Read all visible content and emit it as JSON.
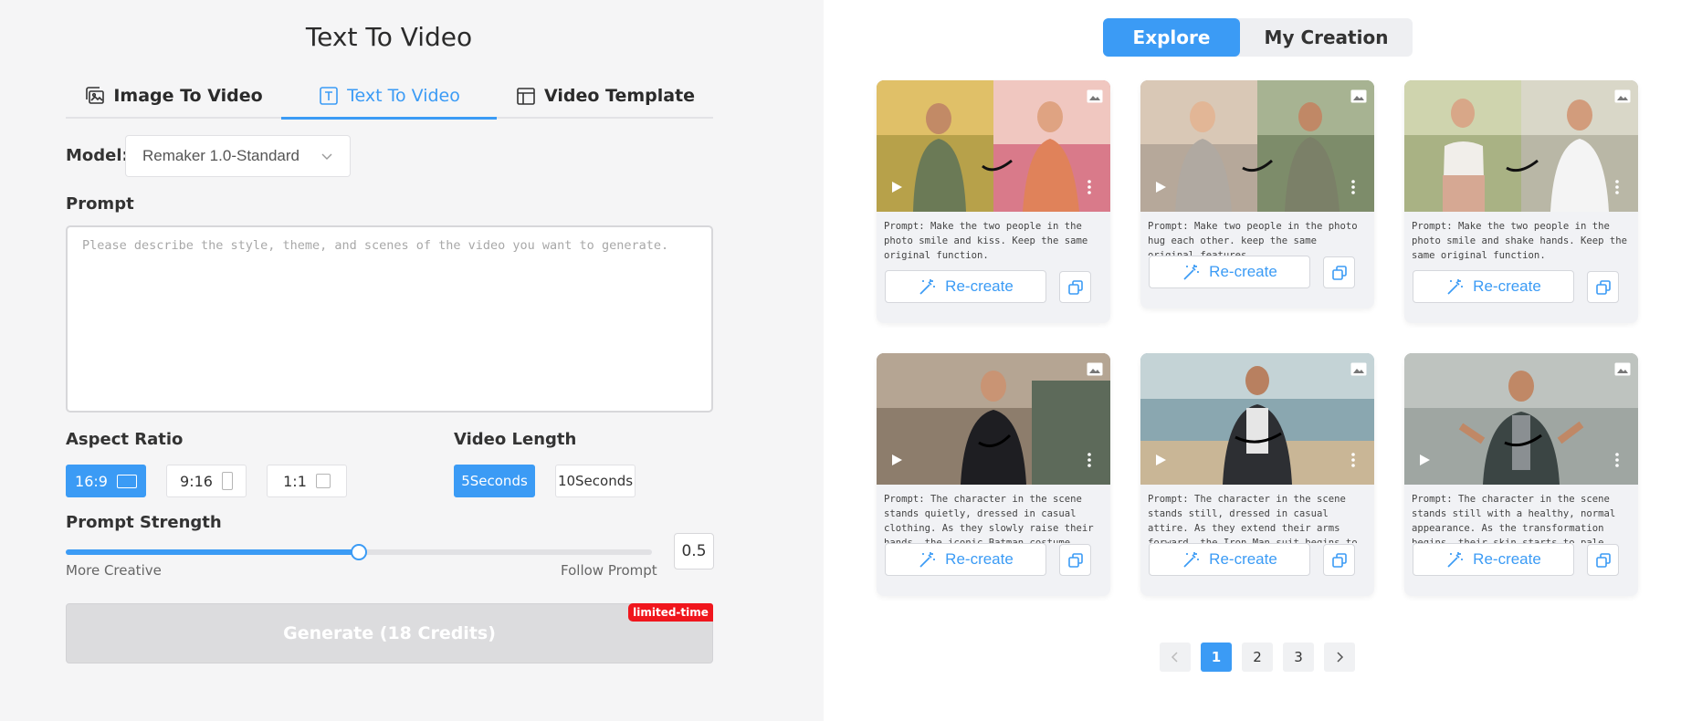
{
  "left_panel": {
    "title": "Text To Video",
    "tabs": [
      {
        "label": "Image To Video",
        "icon": "image-stack-icon",
        "active": false
      },
      {
        "label": "Text To Video",
        "icon": "text-box-icon",
        "active": true
      },
      {
        "label": "Video Template",
        "icon": "template-icon",
        "active": false
      }
    ],
    "model": {
      "label": "Model:",
      "value": "Remaker 1.0-Standard"
    },
    "prompt": {
      "label": "Prompt",
      "placeholder": "Please describe the style, theme, and scenes of the video you want to generate.",
      "value": ""
    },
    "aspect_ratio": {
      "label": "Aspect Ratio",
      "options": [
        "16:9",
        "9:16",
        "1:1"
      ],
      "selected": "16:9"
    },
    "video_length": {
      "label": "Video Length",
      "options": [
        "5Seconds",
        "10Seconds"
      ],
      "selected": "5Seconds"
    },
    "prompt_strength": {
      "label": "Prompt Strength",
      "value": 0.5,
      "value_text": "0.5",
      "left_caption": "More Creative",
      "right_caption": "Follow Prompt"
    },
    "generate": {
      "label": "Generate (18 Credits)",
      "badge": "limited-time"
    }
  },
  "right_panel": {
    "segment": {
      "explore": "Explore",
      "mine": "My Creation",
      "active": "Explore"
    },
    "cards": [
      {
        "prompt": "Prompt: Make the two people in the photo smile and kiss. Keep the same original function.",
        "recreate": "Re-create"
      },
      {
        "prompt": "Prompt: Make two people in the photo hug each other. keep the same original features.",
        "recreate": "Re-create"
      },
      {
        "prompt": "Prompt: Make the two people in the photo smile and shake hands. Keep the same original function.",
        "recreate": "Re-create"
      },
      {
        "prompt": "Prompt: The character in the scene stands quietly, dressed in casual clothing. As they slowly raise their hands, the iconic Batman costume begins to form around their body. Th...",
        "recreate": "Re-create"
      },
      {
        "prompt": "Prompt: The character in the scene stands still, dressed in casual attire. As they extend their arms forward, the Iron Man suit begins to materialize around them. The transformation...",
        "recreate": "Re-create"
      },
      {
        "prompt": "Prompt: The character in the scene stands still with a healthy, normal appearance. As the transformation begins, their skin starts to pale, and veins appear dark and prominent...",
        "recreate": "Re-create"
      }
    ],
    "pagination": {
      "pages": [
        "1",
        "2",
        "3"
      ],
      "current": "1"
    }
  },
  "colors": {
    "accent": "#3b9bf5",
    "left_bg": "#f5f5f6",
    "badge": "#f0161d",
    "disabled_button": "#dcdcde"
  }
}
